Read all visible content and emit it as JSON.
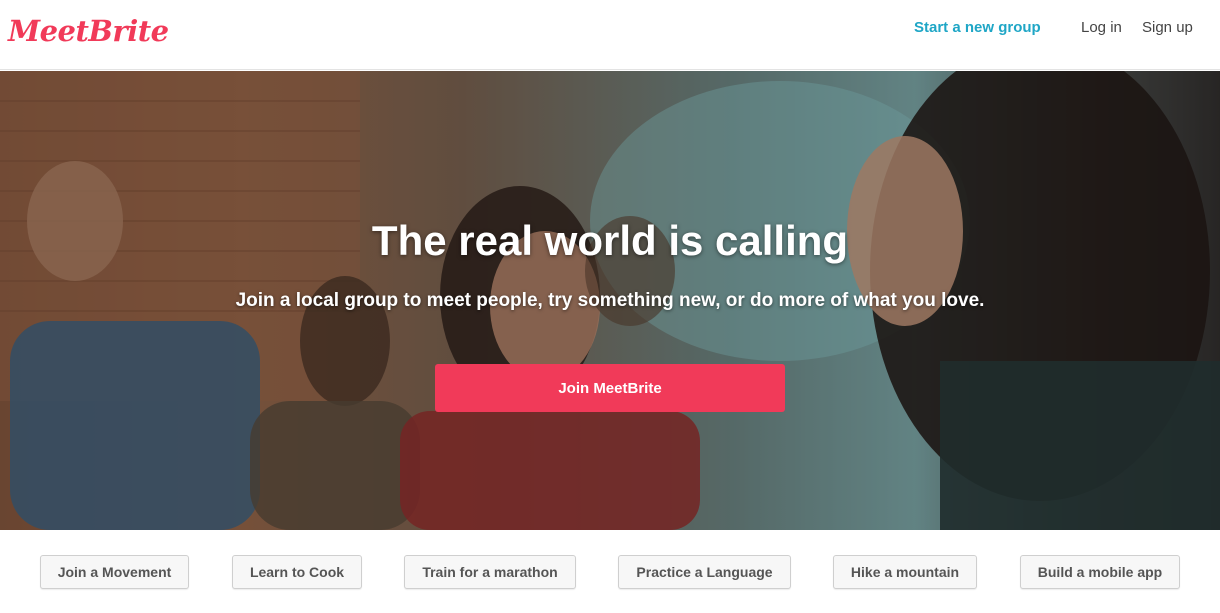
{
  "header": {
    "logo": "MeetBrite",
    "start_group": "Start a new group",
    "log_in": "Log in",
    "sign_up": "Sign up"
  },
  "hero": {
    "title": "The real world is calling",
    "subtitle": "Join a local group to meet people, try something new, or do more of what you love.",
    "cta": "Join MeetBrite"
  },
  "chips": [
    "Join a Movement",
    "Learn to Cook",
    "Train for a marathon",
    "Practice a Language",
    "Hike a mountain",
    "Build a mobile app"
  ],
  "colors": {
    "brand": "#f13a59",
    "link_accent": "#1fa6c6"
  }
}
